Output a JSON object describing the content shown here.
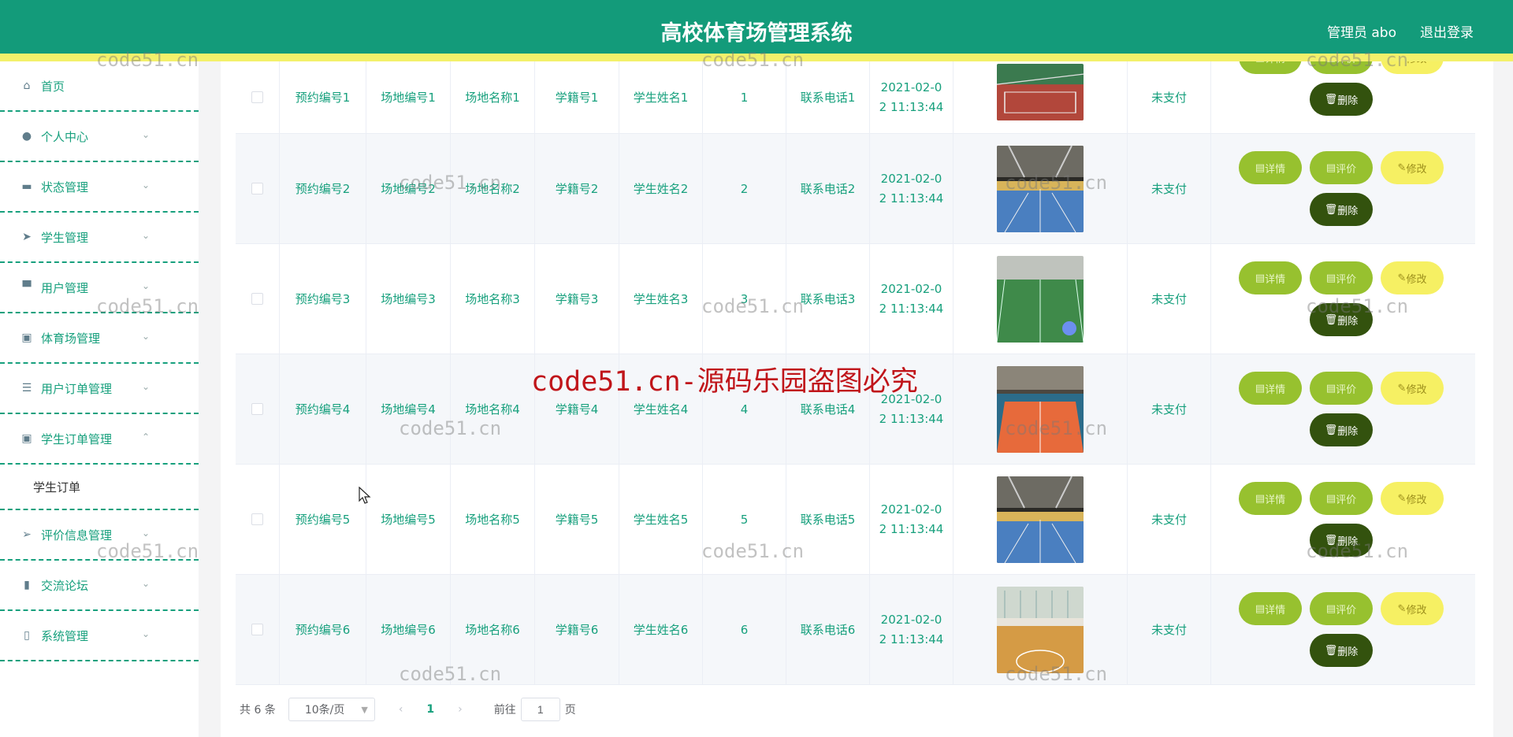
{
  "header": {
    "title": "高校体育场管理系统",
    "user": "管理员 abo",
    "logout": "退出登录"
  },
  "sidebar": {
    "items": [
      {
        "label": "首页",
        "icon": "home-icon",
        "glyph": "⌂",
        "chevron": ""
      },
      {
        "label": "个人中心",
        "icon": "user-icon",
        "glyph": "●",
        "chevron": "⌄"
      },
      {
        "label": "状态管理",
        "icon": "briefcase-icon",
        "glyph": "▬",
        "chevron": "⌄"
      },
      {
        "label": "学生管理",
        "icon": "paper-plane-icon",
        "glyph": "➤",
        "chevron": "⌄"
      },
      {
        "label": "用户管理",
        "icon": "flag-icon",
        "glyph": "▀",
        "chevron": "⌄"
      },
      {
        "label": "体育场管理",
        "icon": "clipboard-icon",
        "glyph": "▣",
        "chevron": "⌄"
      },
      {
        "label": "用户订单管理",
        "icon": "list-icon",
        "glyph": "☰",
        "chevron": "⌄"
      },
      {
        "label": "学生订单管理",
        "icon": "clipboard-check-icon",
        "glyph": "▣",
        "chevron": "⌃"
      }
    ],
    "submenu": {
      "label": "学生订单"
    },
    "items2": [
      {
        "label": "评价信息管理",
        "icon": "send-icon",
        "glyph": "➢",
        "chevron": "⌄"
      },
      {
        "label": "交流论坛",
        "icon": "bar-chart-icon",
        "glyph": "▮",
        "chevron": "⌄"
      },
      {
        "label": "系统管理",
        "icon": "mobile-icon",
        "glyph": "▯",
        "chevron": "⌄"
      }
    ]
  },
  "table": {
    "rows": [
      {
        "booking_no": "预约编号1",
        "venue_no": "场地编号1",
        "venue_name": "场地名称1",
        "student_id": "学籍号1",
        "student_name": "学生姓名1",
        "qty": "1",
        "phone": "联系电话1",
        "time1": "2021-02-0",
        "time2": "2 11:13:44",
        "status": "未支付",
        "img": "outdoor"
      },
      {
        "booking_no": "预约编号2",
        "venue_no": "场地编号2",
        "venue_name": "场地名称2",
        "student_id": "学籍号2",
        "student_name": "学生姓名2",
        "qty": "2",
        "phone": "联系电话2",
        "time1": "2021-02-0",
        "time2": "2 11:13:44",
        "status": "未支付",
        "img": "indoor-blue"
      },
      {
        "booking_no": "预约编号3",
        "venue_no": "场地编号3",
        "venue_name": "场地名称3",
        "student_id": "学籍号3",
        "student_name": "学生姓名3",
        "qty": "3",
        "phone": "联系电话3",
        "time1": "2021-02-0",
        "time2": "2 11:13:44",
        "status": "未支付",
        "img": "green-field"
      },
      {
        "booking_no": "预约编号4",
        "venue_no": "场地编号4",
        "venue_name": "场地名称4",
        "student_id": "学籍号4",
        "student_name": "学生姓名4",
        "qty": "4",
        "phone": "联系电话4",
        "time1": "2021-02-0",
        "time2": "2 11:13:44",
        "status": "未支付",
        "img": "orange-court"
      },
      {
        "booking_no": "预约编号5",
        "venue_no": "场地编号5",
        "venue_name": "场地名称5",
        "student_id": "学籍号5",
        "student_name": "学生姓名5",
        "qty": "5",
        "phone": "联系电话5",
        "time1": "2021-02-0",
        "time2": "2 11:13:44",
        "status": "未支付",
        "img": "indoor-blue"
      },
      {
        "booking_no": "预约编号6",
        "venue_no": "场地编号6",
        "venue_name": "场地名称6",
        "student_id": "学籍号6",
        "student_name": "学生姓名6",
        "qty": "6",
        "phone": "联系电话6",
        "time1": "2021-02-0",
        "time2": "2 11:13:44",
        "status": "未支付",
        "img": "wood-court"
      }
    ],
    "actions": {
      "detail": "详情",
      "evaluate": "评价",
      "edit": "修改",
      "delete": "删除"
    }
  },
  "pagination": {
    "total": "共 6 条",
    "page_size": "10条/页",
    "current": "1",
    "goto_prefix": "前往",
    "goto_value": "1",
    "goto_suffix": "页"
  },
  "watermark": {
    "small": "code51.cn",
    "big": "code51.cn-源码乐园盗图必究"
  },
  "colors": {
    "primary": "#139b7a",
    "accent_yellow": "#f3f06b",
    "green_btn": "#97c12f",
    "dark_btn": "#33520e"
  }
}
